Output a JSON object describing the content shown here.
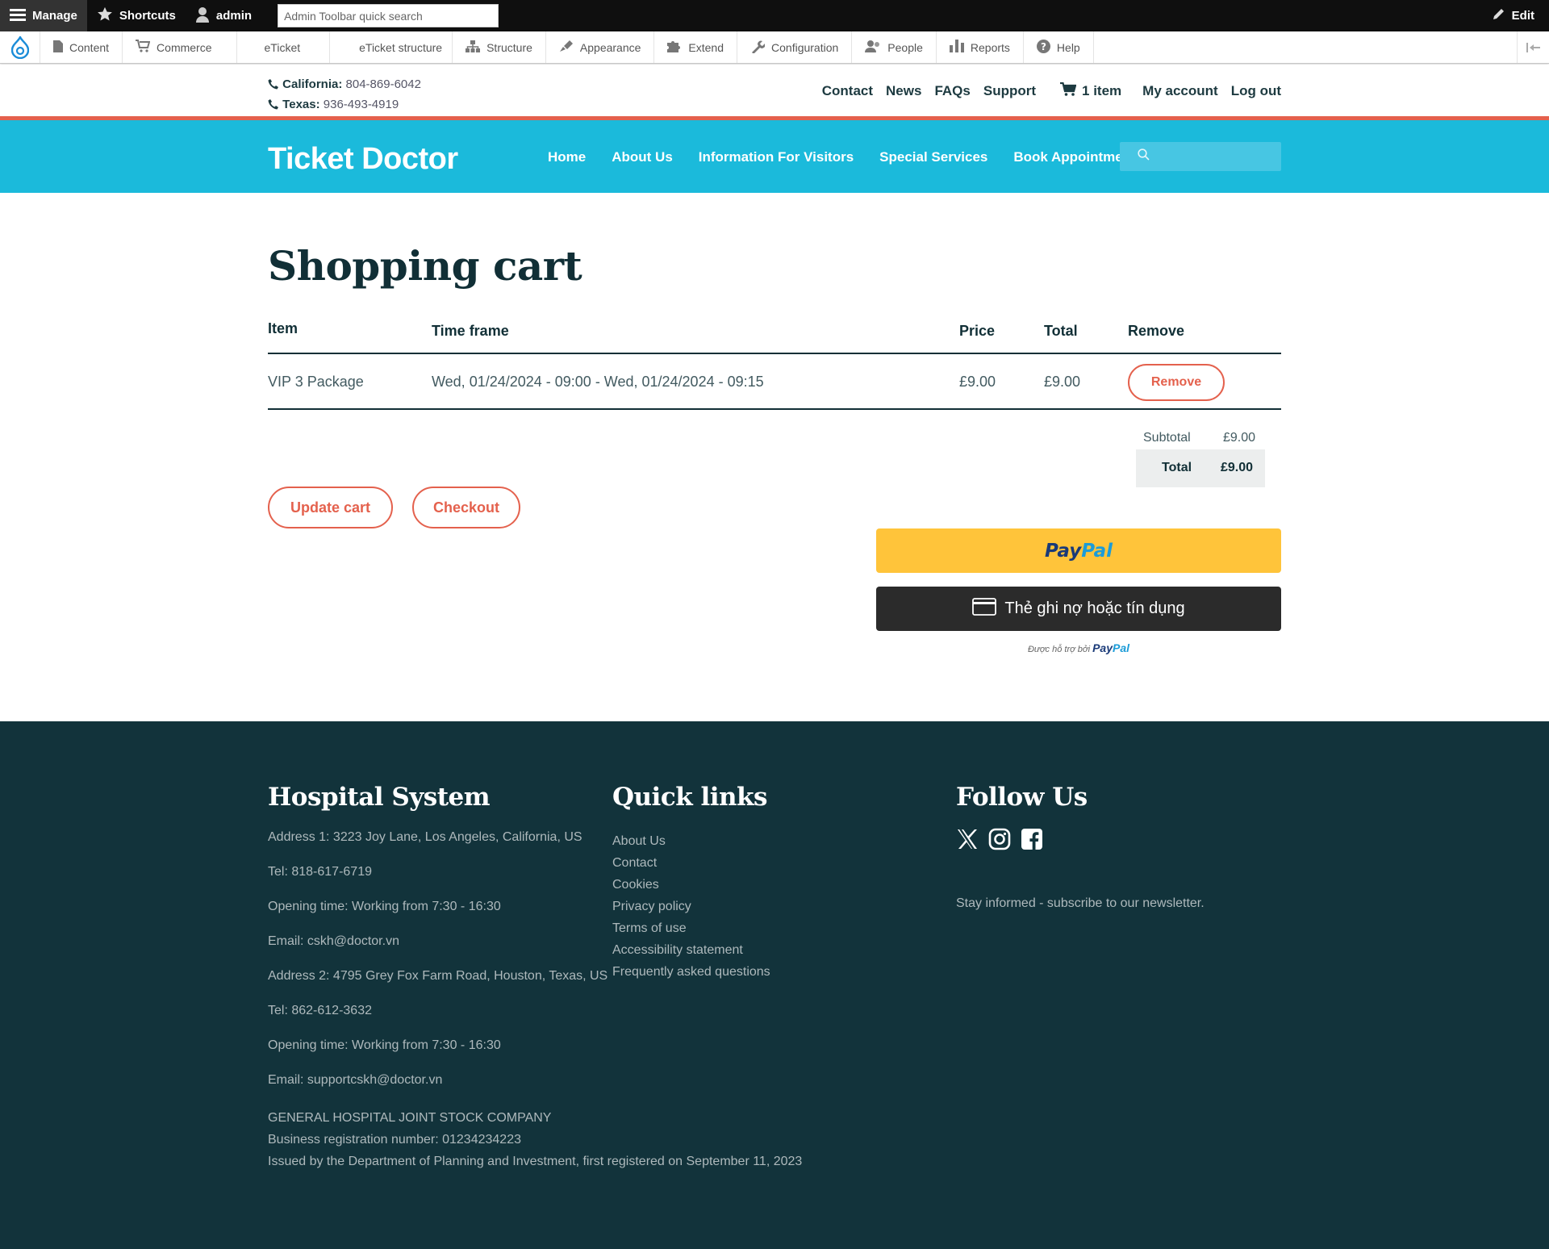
{
  "admin_toolbar": {
    "manage": "Manage",
    "shortcuts": "Shortcuts",
    "user": "admin",
    "search_placeholder": "Admin Toolbar quick search",
    "edit": "Edit"
  },
  "admin_menu": {
    "items": [
      "Content",
      "Commerce",
      "eTicket",
      "eTicket structure",
      "Structure",
      "Appearance",
      "Extend",
      "Configuration",
      "People",
      "Reports",
      "Help"
    ]
  },
  "utility": {
    "california_label": "California:",
    "california_phone": "804-869-6042",
    "texas_label": "Texas:",
    "texas_phone": "936-493-4919",
    "links": [
      "Contact",
      "News",
      "FAQs",
      "Support"
    ],
    "cart": "1 item",
    "my_account": "My account",
    "logout": "Log out"
  },
  "nav": {
    "brand": "Ticket Doctor",
    "items": [
      "Home",
      "About Us",
      "Information For Visitors",
      "Special Services",
      "Book Appointment"
    ]
  },
  "cart": {
    "title": "Shopping cart",
    "headers": {
      "item": "Item",
      "timeframe": "Time frame",
      "price": "Price",
      "total": "Total",
      "remove": "Remove"
    },
    "rows": [
      {
        "item": "VIP 3 Package",
        "timeframe": "Wed, 01/24/2024 - 09:00 - Wed, 01/24/2024 - 09:15",
        "price": "£9.00",
        "total": "£9.00",
        "remove": "Remove"
      }
    ],
    "subtotal_label": "Subtotal",
    "subtotal_value": "£9.00",
    "total_label": "Total",
    "total_value": "£9.00",
    "update_cart": "Update cart",
    "checkout": "Checkout"
  },
  "paypal": {
    "brand_a": "Pay",
    "brand_b": "Pal",
    "card_label": "Thẻ ghi nợ hoặc tín dụng",
    "powered_by": "Được hỗ trợ bởi"
  },
  "footer": {
    "col1_title": "Hospital System",
    "col1_lines": [
      "Address 1: 3223 Joy Lane, Los Angeles, California, US",
      "Tel: 818-617-6719",
      "Opening time: Working from 7:30 - 16:30",
      "Email: cskh@doctor.vn",
      "Address 2: 4795 Grey Fox Farm Road, Houston, Texas, US",
      "Tel: 862-612-3632",
      "Opening time:  Working from 7:30 - 16:30",
      "Email: supportcskh@doctor.vn"
    ],
    "company_lines": [
      "GENERAL HOSPITAL JOINT STOCK COMPANY",
      "Business registration number: 01234234223",
      "Issued by the Department of Planning and Investment, first registered on September 11, 2023"
    ],
    "col2_title": "Quick links",
    "quick_links": [
      "About Us",
      "Contact",
      "Cookies",
      "Privacy policy",
      "Terms of use",
      "Accessibility statement",
      "Frequently asked questions"
    ],
    "col3_title": "Follow Us",
    "social_icons": [
      "x-icon",
      "instagram-icon",
      "facebook-icon"
    ],
    "newsletter": "Stay informed - subscribe to our newsletter."
  },
  "colors": {
    "accent": "#e4614d",
    "nav_bg": "#1bbadb",
    "footer_bg": "#12333b",
    "paypal_yellow": "#ffc43a"
  }
}
